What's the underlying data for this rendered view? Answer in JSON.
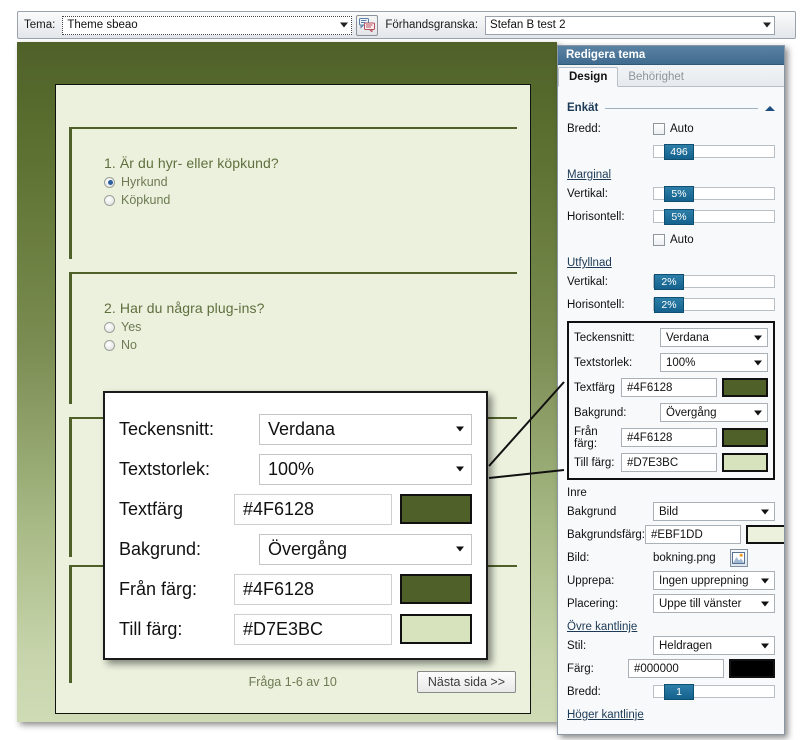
{
  "toolbar": {
    "theme_label": "Tema:",
    "theme_value": "Theme sbeao",
    "chat_icon": "speech-bubbles-icon",
    "preview_label": "Förhandsgranska:",
    "preview_value": "Stefan B test 2"
  },
  "survey": {
    "questions": [
      {
        "title": "1. Är du hyr- eller köpkund?",
        "options": [
          {
            "label": "Hyrkund",
            "selected": true
          },
          {
            "label": "Köpkund",
            "selected": false
          }
        ]
      },
      {
        "title": "2. Har du några plug-ins?",
        "options": [
          {
            "label": "Yes",
            "selected": false
          },
          {
            "label": "No",
            "selected": false
          }
        ]
      }
    ],
    "page_info": "Fråga 1-6 av 10",
    "next_button": "Nästa sida >>"
  },
  "callout": {
    "rows": [
      {
        "label": "Teckensnitt:",
        "value": "Verdana",
        "kind": "select"
      },
      {
        "label": "Textstorlek:",
        "value": "100%",
        "kind": "select"
      },
      {
        "label": "Textfärg",
        "value": "#4F6128",
        "kind": "color",
        "swatch": "#4F6128"
      },
      {
        "label": "Bakgrund:",
        "value": "Övergång",
        "kind": "select"
      },
      {
        "label": "Från färg:",
        "value": "#4F6128",
        "kind": "color",
        "swatch": "#4F6128"
      },
      {
        "label": "Till färg:",
        "value": "#D7E3BC",
        "kind": "color",
        "swatch": "#D7E3BC"
      }
    ]
  },
  "panel": {
    "title": "Redigera tema",
    "tabs": [
      {
        "label": "Design",
        "active": true
      },
      {
        "label": "Behörighet",
        "active": false
      }
    ],
    "section_enkat": {
      "heading": "Enkät",
      "collapse_icon": "chevron-up-icon",
      "bredd_label": "Bredd:",
      "bredd_auto_label": "Auto",
      "bredd_value": "496",
      "marginal_heading": "Marginal",
      "marginal_vertikal_label": "Vertikal:",
      "marginal_vertikal_value": "5%",
      "marginal_horisontell_label": "Horisontell:",
      "marginal_horisontell_value": "5%",
      "marginal_auto_label": "Auto",
      "utfyllnad_heading": "Utfyllnad",
      "utfyllnad_vertikal_label": "Vertikal:",
      "utfyllnad_vertikal_value": "2%",
      "utfyllnad_horisontell_label": "Horisontell:",
      "utfyllnad_horisontell_value": "2%"
    },
    "highlight": {
      "rows": [
        {
          "label": "Teckensnitt:",
          "value": "Verdana",
          "kind": "select"
        },
        {
          "label": "Textstorlek:",
          "value": "100%",
          "kind": "select"
        },
        {
          "label": "Textfärg",
          "value": "#4F6128",
          "kind": "color",
          "swatch": "#4F6128"
        },
        {
          "label": "Bakgrund:",
          "value": "Övergång",
          "kind": "select"
        },
        {
          "label": "Från färg:",
          "value": "#4F6128",
          "kind": "color",
          "swatch": "#4F6128"
        },
        {
          "label": "Till färg:",
          "value": "#D7E3BC",
          "kind": "color",
          "swatch": "#D7E3BC"
        }
      ]
    },
    "section_inre": {
      "heading": "Inre",
      "bakgrund_label": "Bakgrund",
      "bakgrund_value": "Bild",
      "bakgrundsfarg_label": "Bakgrundsfärg:",
      "bakgrundsfarg_value": "#EBF1DD",
      "bakgrundsfarg_swatch": "#EBF1DD",
      "bild_label": "Bild:",
      "bild_value": "bokning.png",
      "bild_icon": "picture-icon",
      "upprepa_label": "Upprepa:",
      "upprepa_value": "Ingen upprepning",
      "placering_label": "Placering:",
      "placering_value": "Uppe till vänster"
    },
    "section_ovre_kantlinje": {
      "heading": "Övre kantlinje",
      "stil_label": "Stil:",
      "stil_value": "Heldragen",
      "farg_label": "Färg:",
      "farg_value": "#000000",
      "farg_swatch": "#000000",
      "bredd_label": "Bredd:",
      "bredd_value": "1"
    },
    "section_hoger_kantlinje": {
      "heading": "Höger kantlinje"
    }
  },
  "colors": {
    "accent_green": "#4F6128",
    "light_green": "#D7E3BC",
    "panel_blue": "#3F6B8F",
    "slider_blue": "#14628D"
  }
}
